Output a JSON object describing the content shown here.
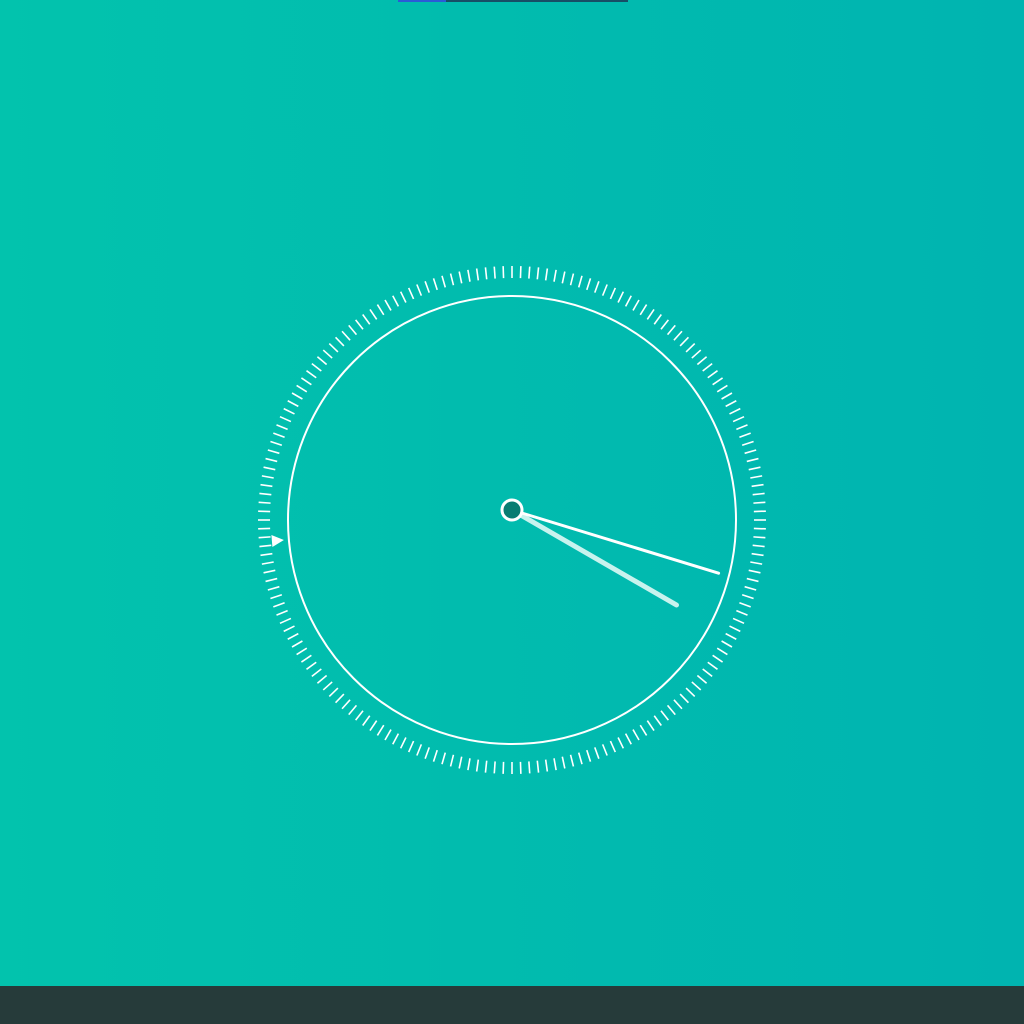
{
  "colors": {
    "background_left": "#02c3ad",
    "background_right": "#00b4b0",
    "dial": "#ffffff",
    "minute_hand": "#ffffff",
    "second_hand": "#c8f3ee",
    "center_dot": "#0a7d72",
    "bottom_bar": "#263b3a",
    "top_indicator_left": "#2b5bd6",
    "top_indicator_right": "#174e66"
  },
  "clock": {
    "tick_count": 180,
    "minute_hand_angle_deg": 107,
    "second_hand_angle_deg": 120,
    "pointer_marker_angle_deg": 265,
    "icons": {
      "marker": "triangle-pointer-icon",
      "center": "hub-icon"
    }
  }
}
